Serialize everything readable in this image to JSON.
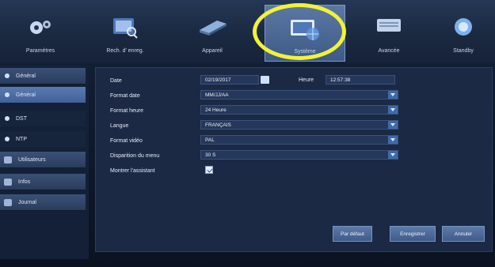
{
  "menu": [
    {
      "label": "Paramètres",
      "icon": "gear-icon"
    },
    {
      "label": "Rech. d' enreg.",
      "icon": "search-icon"
    },
    {
      "label": "Appareil",
      "icon": "hard-disk-icon"
    },
    {
      "label": "Système",
      "icon": "monitor-globe-icon"
    },
    {
      "label": "Avancée",
      "icon": "keyboard-icon"
    },
    {
      "label": "Standby",
      "icon": "power-icon"
    }
  ],
  "sidebar": [
    {
      "label": "Général",
      "type": "main"
    },
    {
      "label": "Général",
      "type": "sub"
    },
    {
      "label": "DST",
      "type": "sub"
    },
    {
      "label": "NTP",
      "type": "sub"
    },
    {
      "label": "Utilisateurs",
      "type": "main"
    },
    {
      "label": "Infos",
      "type": "main"
    },
    {
      "label": "Journal",
      "type": "main"
    }
  ],
  "form": {
    "date_label": "Date",
    "date_value": "02/19/2017",
    "time_label": "Heure",
    "time_value": "12:57:38",
    "date_format_label": "Format date",
    "date_format_value": "MM/JJ/AA",
    "time_format_label": "Format heure",
    "time_format_value": "24 Heure",
    "language_label": "Langue",
    "language_value": "FRANÇAIS",
    "video_format_label": "Format vidéo",
    "video_format_value": "PAL",
    "menu_timeout_label": "Disparition du menu",
    "menu_timeout_value": "30 S",
    "wizard_label": "Montrer l'assistant",
    "wizard_checked": true
  },
  "buttons": {
    "default": "Par défaut",
    "save": "Enregistrer",
    "cancel": "Annuler"
  },
  "colors": {
    "highlight": "#f2f238",
    "accent": "#3f6aa8"
  }
}
